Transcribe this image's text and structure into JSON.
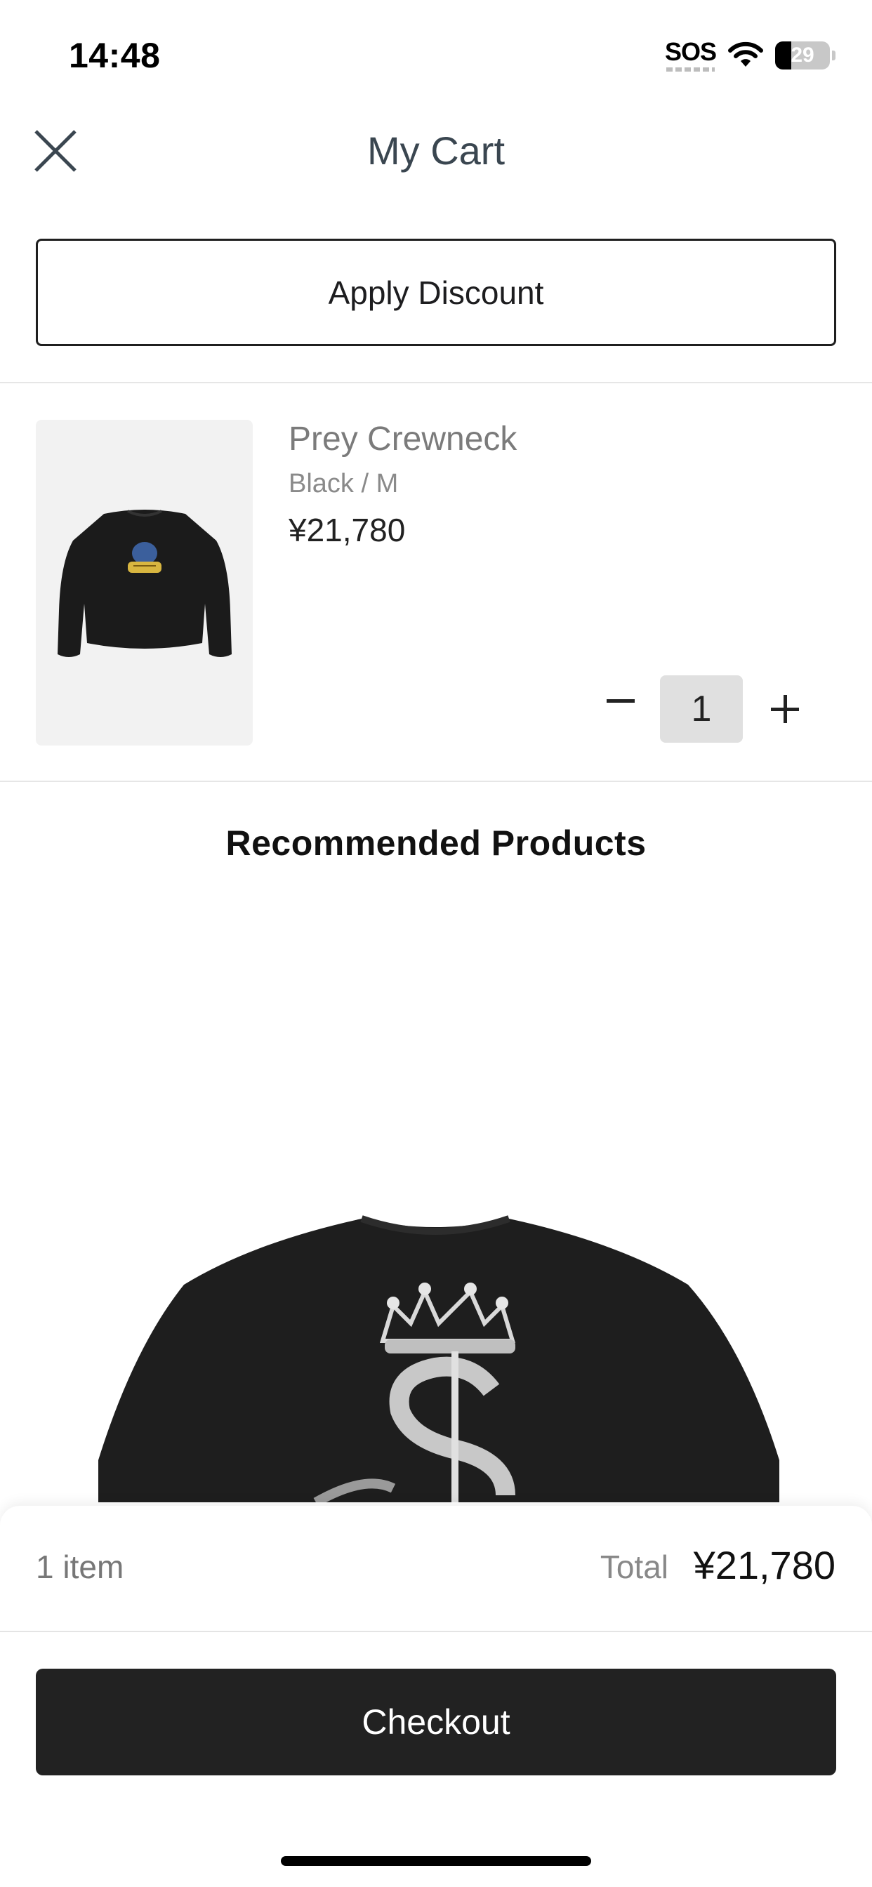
{
  "status_bar": {
    "time": "14:48",
    "sos": "SOS",
    "battery": "29",
    "battery_level": 0.29,
    "icons": [
      "wifi-icon",
      "battery-icon"
    ]
  },
  "header": {
    "title": "My Cart",
    "close_icon": "close-icon"
  },
  "discount": {
    "label": "Apply Discount"
  },
  "cart_item": {
    "name": "Prey Crewneck",
    "variant": "Black / M",
    "price": "¥21,780",
    "quantity": "1",
    "image": "black-crewneck-sweatshirt",
    "decrement_icon": "minus-icon",
    "increment_icon": "plus-icon"
  },
  "recommended": {
    "title": "Recommended Products",
    "image": "black-tshirt-crown-dollar-print"
  },
  "summary": {
    "item_count": "1 item",
    "total_label": "Total",
    "total_value": "¥21,780",
    "checkout_label": "Checkout"
  },
  "colors": {
    "primary_button": "#222222",
    "title_text": "#3a4650",
    "muted_text": "#7b7b7b"
  }
}
